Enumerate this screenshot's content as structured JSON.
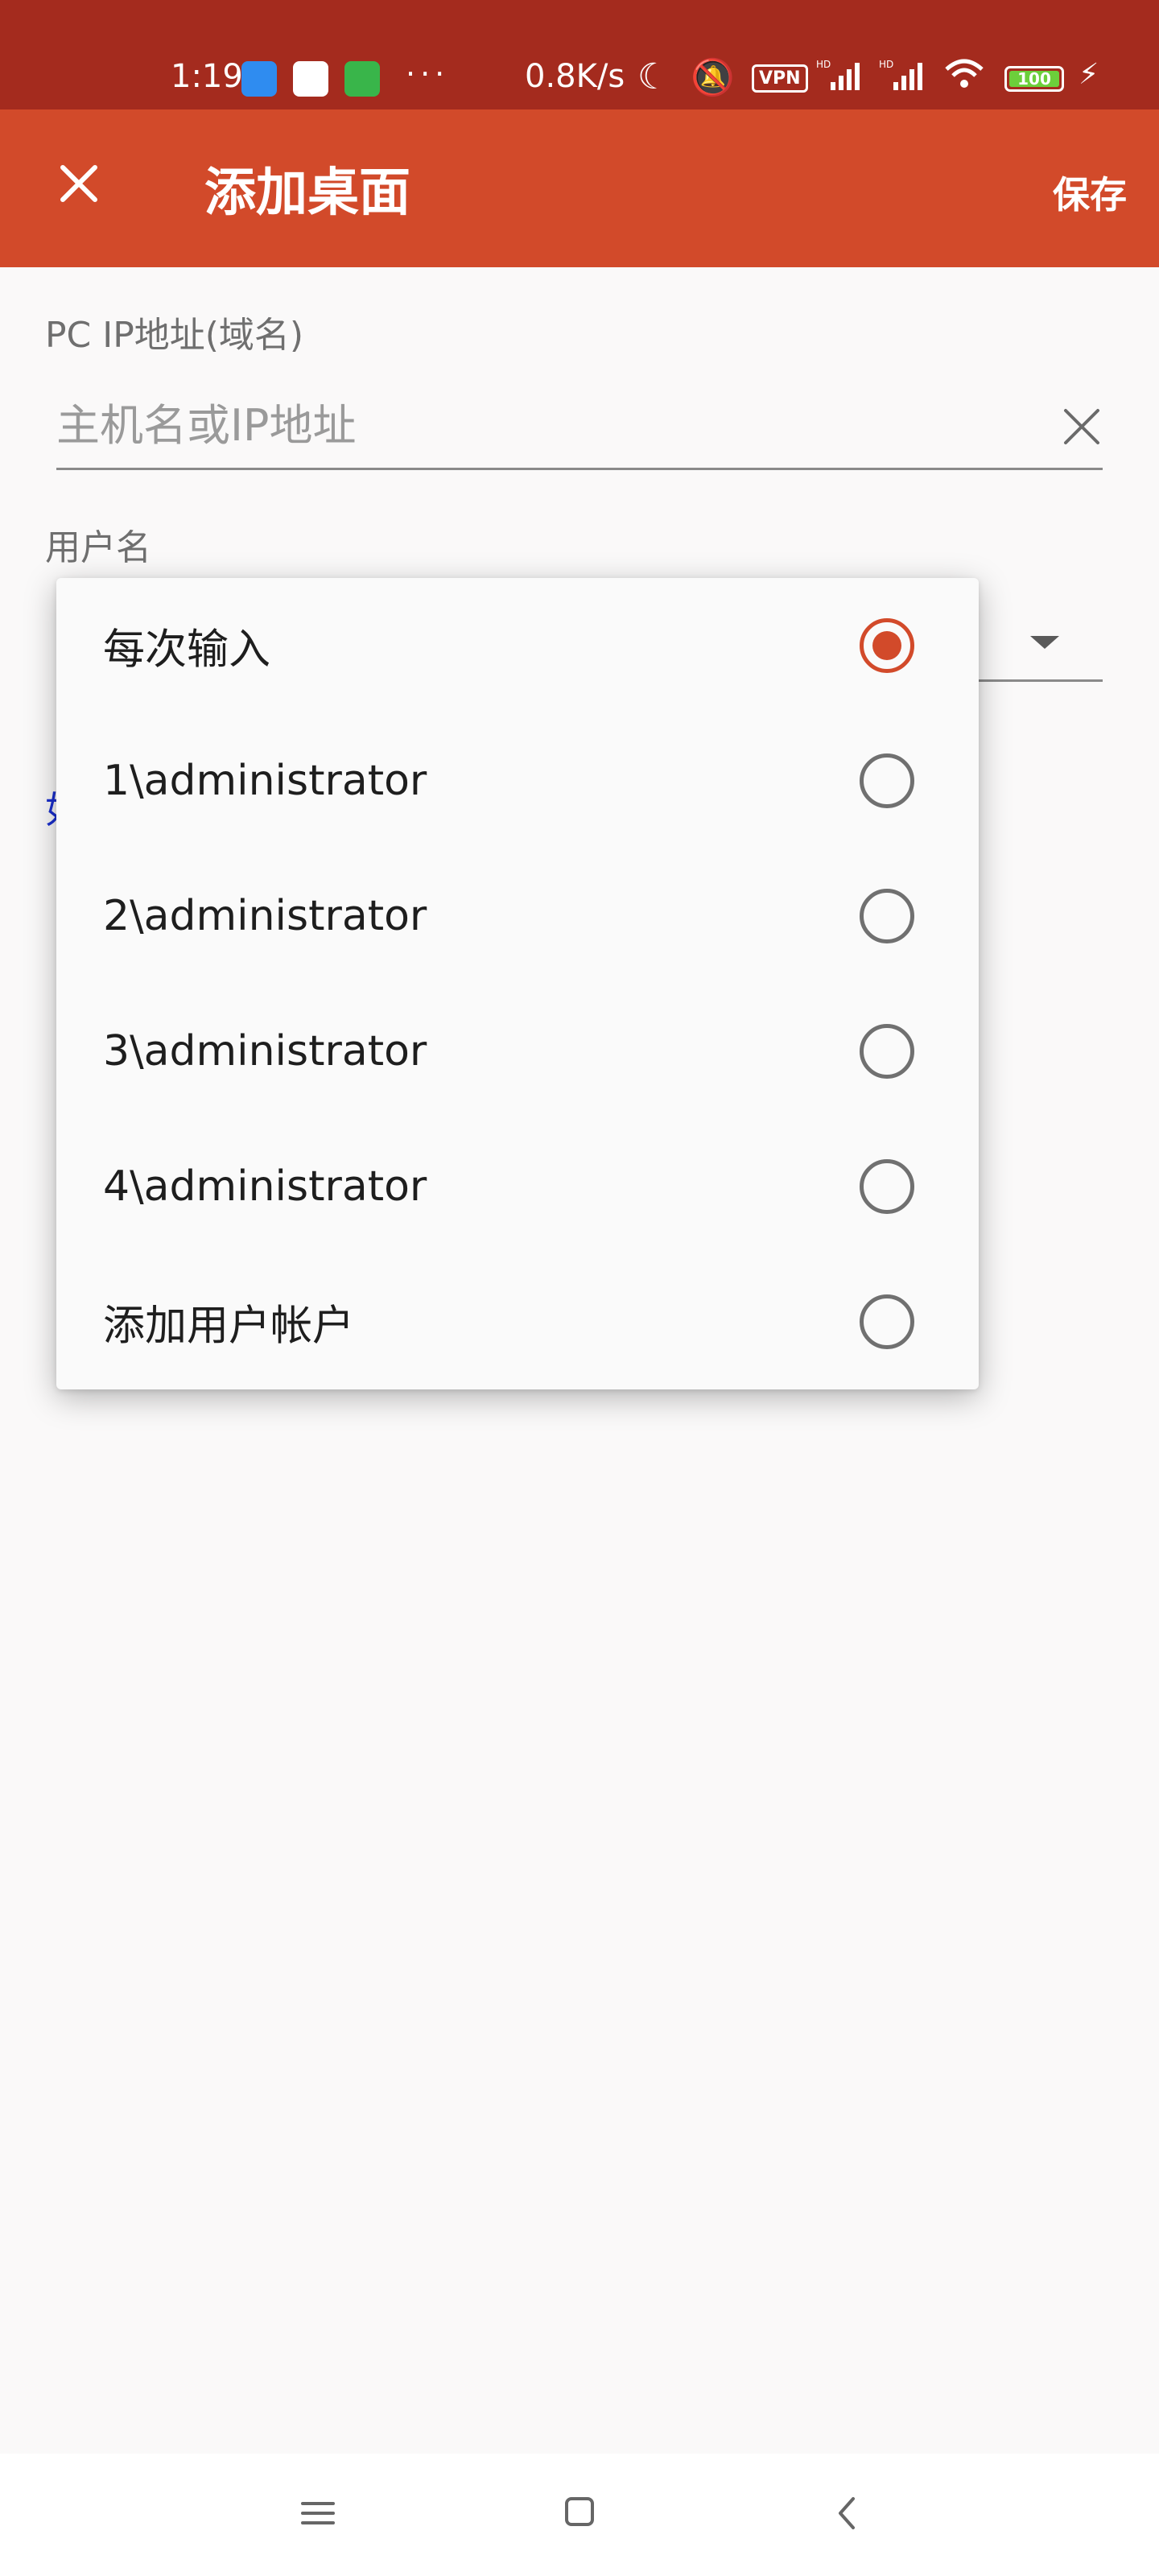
{
  "status_bar": {
    "time": "1:19",
    "notifications": [
      "browser-app-icon",
      "mail-app-icon",
      "wechat-app-icon"
    ],
    "more": "···",
    "net_speed": "0.8K/s",
    "vpn": "VPN",
    "signal1": "HD",
    "signal2": "HD",
    "battery": "100",
    "colors": {
      "background": "#a42b1e"
    }
  },
  "app_bar": {
    "title": "添加桌面",
    "save_label": "保存",
    "colors": {
      "background": "#d24a2a"
    }
  },
  "form": {
    "host_label": "PC IP地址(域名)",
    "host_placeholder": "主机名或IP地址",
    "host_value": "",
    "username_label": "用户名",
    "obscured_link_char": "如"
  },
  "username_menu": {
    "options": [
      {
        "label": "每次输入",
        "checked": true
      },
      {
        "label": "1\\administrator",
        "checked": false
      },
      {
        "label": "2\\administrator",
        "checked": false
      },
      {
        "label": "3\\administrator",
        "checked": false
      },
      {
        "label": "4\\administrator",
        "checked": false
      },
      {
        "label": "添加用户帐户",
        "checked": false
      }
    ],
    "accent_color": "#d24a2a"
  },
  "nav_bar": {
    "buttons": [
      "menu-icon",
      "home-icon",
      "back-icon"
    ]
  }
}
